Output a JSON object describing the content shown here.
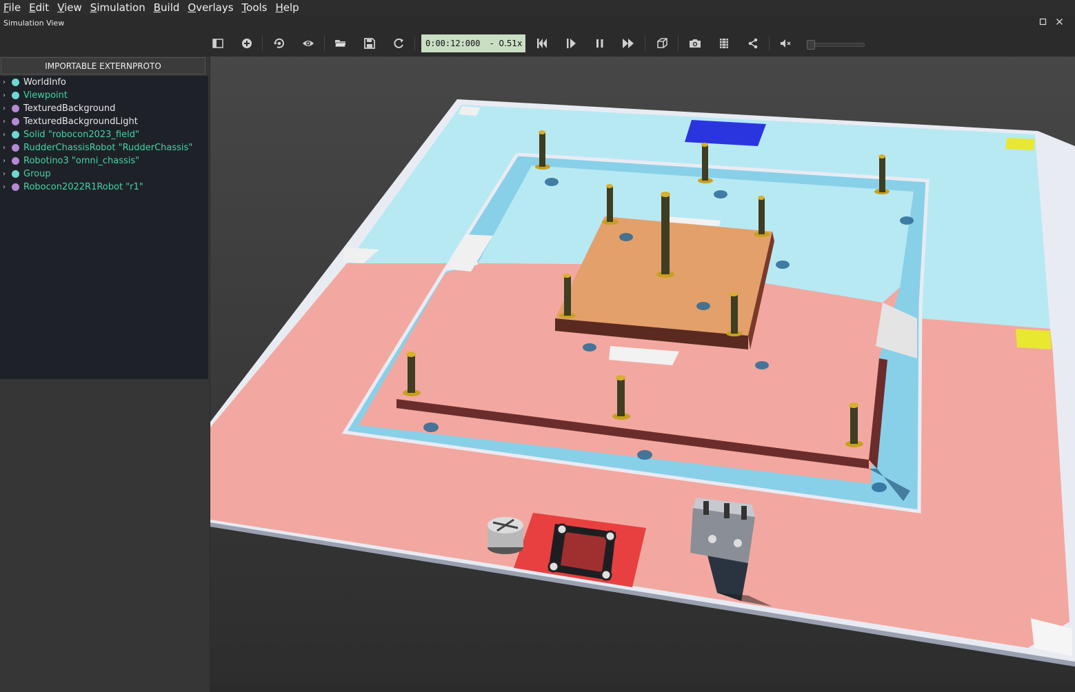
{
  "menubar": {
    "items": [
      "File",
      "Edit",
      "View",
      "Simulation",
      "Build",
      "Overlays",
      "Tools",
      "Help"
    ]
  },
  "panel": {
    "title": "Simulation View",
    "maximize_icon": "maximize-icon",
    "close_icon": "close-icon"
  },
  "toolbar": {
    "buttons": [
      {
        "name": "toggle-scene-tree-button",
        "icon": "sidebar-icon"
      },
      {
        "name": "add-node-button",
        "icon": "plus-circle-icon"
      },
      {
        "name": "reset-viewpoint-button",
        "icon": "reset-view-icon"
      },
      {
        "name": "view-options-button",
        "icon": "eye-icon"
      },
      {
        "name": "open-world-button",
        "icon": "folder-icon"
      },
      {
        "name": "save-world-button",
        "icon": "save-icon"
      },
      {
        "name": "reload-world-button",
        "icon": "reload-icon"
      },
      {
        "name": "reset-simulation-button",
        "icon": "skip-back-icon"
      },
      {
        "name": "step-button",
        "icon": "step-icon"
      },
      {
        "name": "pause-button",
        "icon": "pause-icon"
      },
      {
        "name": "fast-forward-button",
        "icon": "fast-forward-icon"
      },
      {
        "name": "rendering-button",
        "icon": "cube-icon"
      },
      {
        "name": "screenshot-button",
        "icon": "camera-icon"
      },
      {
        "name": "movie-button",
        "icon": "film-icon"
      },
      {
        "name": "share-button",
        "icon": "share-icon"
      },
      {
        "name": "mute-button",
        "icon": "mute-icon"
      }
    ],
    "time": "0:00:12:000",
    "speed_sep": "-",
    "speed": "0.51x",
    "volume": 0.0
  },
  "scene_tree": {
    "import_button": "IMPORTABLE EXTERNPROTO",
    "nodes": [
      {
        "label": "WorldInfo",
        "dot": "#6fd7d3",
        "kind": "plain"
      },
      {
        "label": "Viewpoint",
        "dot": "#6fd7d3",
        "kind": "proto"
      },
      {
        "label": "TexturedBackground",
        "dot": "#b489d6",
        "kind": "plain"
      },
      {
        "label": "TexturedBackgroundLight",
        "dot": "#b489d6",
        "kind": "plain"
      },
      {
        "label": "Solid \"robocon2023_field\"",
        "dot": "#6fd7d3",
        "kind": "proto"
      },
      {
        "label": "RudderChassisRobot \"RudderChassis\"",
        "dot": "#b489d6",
        "kind": "proto"
      },
      {
        "label": "Robotino3 \"omni_chassis\"",
        "dot": "#b489d6",
        "kind": "proto"
      },
      {
        "label": "Group",
        "dot": "#6fd7d3",
        "kind": "proto"
      },
      {
        "label": "Robocon2022R1Robot \"r1\"",
        "dot": "#b489d6",
        "kind": "proto"
      }
    ]
  },
  "scene": {
    "colors": {
      "background": "#3a3a3a",
      "wall": "#e8eaf2",
      "blue_zone": "#b7e9f3",
      "blue_track": "#88d0e8",
      "red_zone": "#f2a8a0",
      "center_platform": "#e3a06a",
      "pole": "#3f3d22",
      "pole_base": "#c8a020",
      "blue_marker": "#2a35e0",
      "yellow_marker": "#e8e830",
      "start_zone": "#e84040"
    }
  }
}
